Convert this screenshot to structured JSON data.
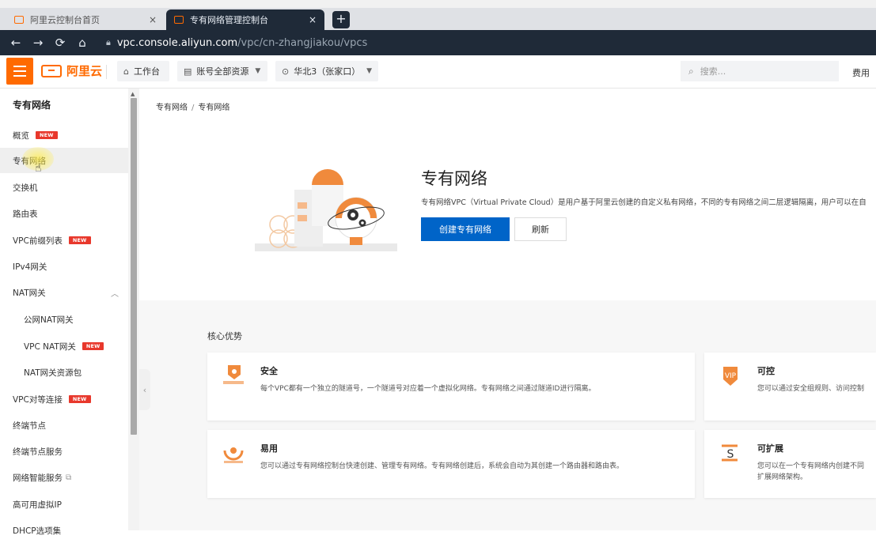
{
  "browser": {
    "tabs": [
      {
        "title": "阿里云控制台首页"
      },
      {
        "title": "专有网络管理控制台"
      }
    ],
    "close_glyph": "×",
    "new_tab_glyph": "+",
    "url_host": "vpc.console.aliyun.com",
    "url_path": "/vpc/cn-zhangjiakou/vpcs"
  },
  "header": {
    "logo_text": "阿里云",
    "workbench": "工作台",
    "account_scope": "账号全部资源",
    "region": "华北3（张家口）",
    "search_placeholder": "搜索...",
    "fee": "费用"
  },
  "sidebar": {
    "title": "专有网络",
    "badge_text": "NEW",
    "items": [
      {
        "label": "概览"
      },
      {
        "label": "专有网络"
      },
      {
        "label": "交换机"
      },
      {
        "label": "路由表"
      },
      {
        "label": "VPC前缀列表"
      },
      {
        "label": "IPv4网关"
      },
      {
        "label": "NAT网关"
      },
      {
        "label": "公网NAT网关"
      },
      {
        "label": "VPC NAT网关"
      },
      {
        "label": "NAT网关资源包"
      },
      {
        "label": "VPC对等连接"
      },
      {
        "label": "终端节点"
      },
      {
        "label": "终端节点服务"
      },
      {
        "label": "网络智能服务"
      },
      {
        "label": "高可用虚拟IP"
      },
      {
        "label": "DHCP选项集"
      }
    ]
  },
  "main": {
    "breadcrumb": [
      "专有网络",
      "专有网络"
    ],
    "breadcrumb_sep": "/",
    "hero": {
      "title": "专有网络",
      "description": "专有网络VPC（Virtual Private Cloud）是用户基于阿里云创建的自定义私有网络，不同的专有网络之间二层逻辑隔离，用户可以在自",
      "create_button": "创建专有网络",
      "refresh_button": "刷新"
    },
    "advantages_title": "核心优势",
    "cards": [
      {
        "title": "安全",
        "desc": "每个VPC都有一个独立的隧道号，一个隧道号对应着一个虚拟化网络。专有网络之间通过隧道ID进行隔离。"
      },
      {
        "title": "可控",
        "desc": "您可以通过安全组规则、访问控制"
      },
      {
        "title": "易用",
        "desc": "您可以通过专有网络控制台快速创建、管理专有网络。专有网络创建后，系统会自动为其创建一个路由器和路由表。"
      },
      {
        "title": "可扩展",
        "desc": "您可以在一个专有网络内创建不同",
        "desc2": "扩展网络架构。"
      }
    ]
  },
  "colors": {
    "brand": "#ff6a00",
    "primary": "#0064c8",
    "badge": "#e8382c"
  }
}
